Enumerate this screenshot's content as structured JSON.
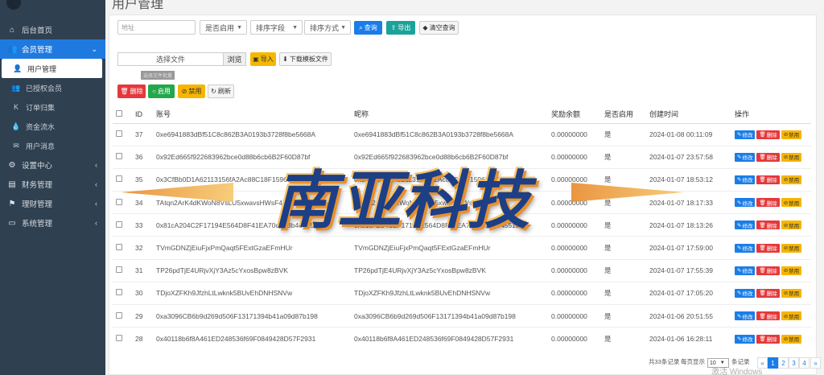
{
  "page": {
    "title": "用户管理"
  },
  "sidebar": {
    "items": [
      {
        "label": "后台首页",
        "icon": "home-icon"
      },
      {
        "label": "会员管理",
        "icon": "users-icon",
        "active": true
      },
      {
        "label": "用户管理",
        "icon": "user-icon",
        "sub": true,
        "active": true
      },
      {
        "label": "已授权会员",
        "icon": "users-icon",
        "sub": true
      },
      {
        "label": "订单归集",
        "icon": "k-icon",
        "sub": true
      },
      {
        "label": "资金流水",
        "icon": "drop-icon",
        "sub": true
      },
      {
        "label": "用户消息",
        "icon": "envelope-icon",
        "sub": true
      },
      {
        "label": "设置中心",
        "icon": "gears-icon"
      },
      {
        "label": "财务管理",
        "icon": "money-icon"
      },
      {
        "label": "理财管理",
        "icon": "flag-icon"
      },
      {
        "label": "系统管理",
        "icon": "desktop-icon"
      }
    ]
  },
  "filters": {
    "address_placeholder": "地址",
    "enabled_select": "是否启用",
    "sort_field_select": "排序字段",
    "sort_order_select": "排序方式",
    "search_label": "查询",
    "export_label": "导出",
    "clear_label": "清空查询"
  },
  "import": {
    "file_label": "选择文件",
    "browse_label": "浏览",
    "import_label": "导入",
    "download_label": "下载模板文件",
    "tooltip": "选择文件批量"
  },
  "actions": {
    "delete_label": "删除",
    "enable_label": "启用",
    "disable_label": "禁用",
    "refresh_label": "刷新"
  },
  "table": {
    "headers": [
      "ID",
      "账号",
      "昵称",
      "奖励余额",
      "是否启用",
      "创建时间",
      "操作"
    ],
    "op_labels": {
      "edit": "修改",
      "delete": "删除",
      "ban": "禁用"
    },
    "rows": [
      {
        "id": "37",
        "account": "0xe6941883dBf51C8c862B3A0193b3728f8be5668A",
        "nickname": "0xe6941883dBf51C8c862B3A0193b3728f8be5668A",
        "balance": "0.00000000",
        "enabled": "是",
        "created": "2024-01-08 00:11:09"
      },
      {
        "id": "36",
        "account": "0x92Ed665f922683962bce0d88b6cb6B2F60D87bf",
        "nickname": "0x92Ed665f922683962bce0d88b6cb6B2F60D87bf",
        "balance": "0.00000000",
        "enabled": "是",
        "created": "2024-01-07 23:57:58"
      },
      {
        "id": "35",
        "account": "0x3CfBb0D1A62113156fA2Ac88C18F15968750D000",
        "nickname": "0x3CfBb0D1A62113156fA2Ac88C18F15968750D000",
        "balance": "0.00000000",
        "enabled": "是",
        "created": "2024-01-07 18:53:12"
      },
      {
        "id": "34",
        "account": "TAtqn2ArK4dKWoN8VsLU5xwavsHWsF4bt",
        "nickname": "TAtqn2ArK4dKWoN8VsLU5xwavsHWsF4bt",
        "balance": "0.00000000",
        "enabled": "是",
        "created": "2024-01-07 18:17:33"
      },
      {
        "id": "33",
        "account": "0x81cA204C2F17194E564D8F41EA70cE53b4e4551d",
        "nickname": "0x81cA204C2F17194E564D8F41EA70cE53b4e4551d",
        "balance": "0.00000000",
        "enabled": "是",
        "created": "2024-01-07 18:13:26"
      },
      {
        "id": "32",
        "account": "TVmGDNZjEiuFjxPmQaqt5FExtGzaEFmHUr",
        "nickname": "TVmGDNZjEiuFjxPmQaqt5FExtGzaEFmHUr",
        "balance": "0.00000000",
        "enabled": "是",
        "created": "2024-01-07 17:59:00"
      },
      {
        "id": "31",
        "account": "TP26pdTjE4URjvXjY3Az5cYxosBpw8zBVK",
        "nickname": "TP26pdTjE4URjvXjY3Az5cYxosBpw8zBVK",
        "balance": "0.00000000",
        "enabled": "是",
        "created": "2024-01-07 17:55:39"
      },
      {
        "id": "30",
        "account": "TDjoXZFKh9JfzhLtLwknk5BUvEhDNHSNVw",
        "nickname": "TDjoXZFKh9JfzhLtLwknk5BUvEhDNHSNVw",
        "balance": "0.00000000",
        "enabled": "是",
        "created": "2024-01-07 17:05:20"
      },
      {
        "id": "29",
        "account": "0xa3096CB6b9d269d506F13171394b41a09d87b198",
        "nickname": "0xa3096CB6b9d269d506F13171394b41a09d87b198",
        "balance": "0.00000000",
        "enabled": "是",
        "created": "2024-01-06 20:51:55"
      },
      {
        "id": "28",
        "account": "0x40118b6f8A461ED248536f69F0849428D57F2931",
        "nickname": "0x40118b6f8A461ED248536f69F0849428D57F2931",
        "balance": "0.00000000",
        "enabled": "是",
        "created": "2024-01-06 16:28:11"
      }
    ]
  },
  "pagination": {
    "total_text": "共33条记录",
    "per_page_prefix": "每页显示",
    "per_page_value": "10",
    "per_page_suffix": "条记录",
    "prev": "«",
    "pages": [
      "1",
      "2",
      "3",
      "4"
    ],
    "next": "»",
    "current": "1"
  },
  "watermark": {
    "text": "南亚科技"
  },
  "os_overlay": {
    "text": "激活 Windows"
  }
}
